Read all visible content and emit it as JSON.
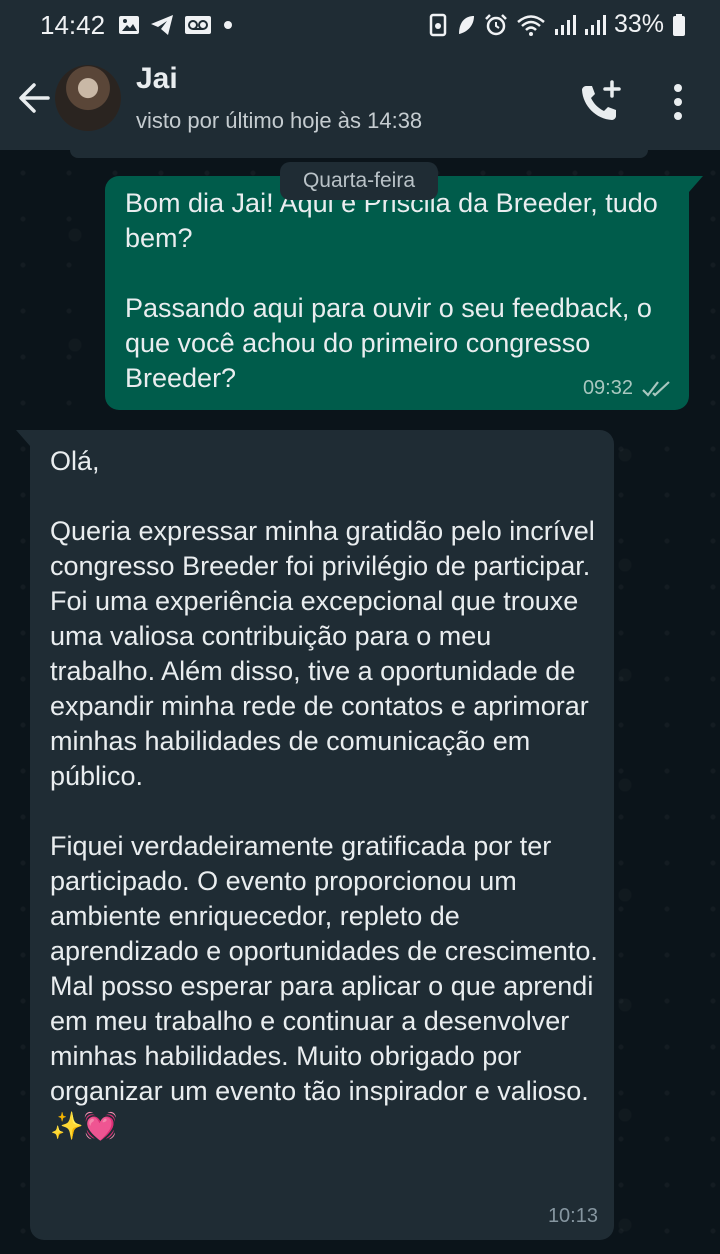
{
  "status_bar": {
    "time": "14:42",
    "battery_text": "33%"
  },
  "header": {
    "contact_name": "Jai",
    "last_seen": "visto por último hoje às 14:38"
  },
  "chat": {
    "date_label": "Quarta-feira",
    "outgoing": {
      "text": "Bom dia Jai! Aqui é Priscila da Breeder, tudo bem?\n\nPassando aqui para ouvir o seu feedback, o que você achou do primeiro congresso Breeder?",
      "time": "09:32",
      "status": "read"
    },
    "incoming": {
      "text": "Olá,\n\nQueria expressar minha gratidão pelo incrível congresso Breeder foi privilégio de participar. Foi uma experiência excepcional que trouxe uma valiosa contribuição para o meu trabalho. Além disso, tive a oportunidade de expandir minha rede de contatos e aprimorar minhas habilidades de comunicação em público.\n\nFiquei verdadeiramente gratificada por ter participado. O evento proporcionou um ambiente enriquecedor, repleto de aprendizado e oportunidades de crescimento. Mal posso esperar para aplicar o que aprendi em meu trabalho e continuar a desenvolver minhas habilidades. Muito obrigado por organizar um evento tão inspirador e valioso. ✨💓",
      "time": "10:13"
    }
  },
  "colors": {
    "header_bg": "#1f2c34",
    "chat_bg": "#0b141a",
    "outgoing_bubble": "#005c4b",
    "incoming_bubble": "#1f2c34",
    "read_ticks": "#a8c7bf"
  },
  "icons": {
    "status_left": [
      "gallery-icon",
      "telegram-icon",
      "voicemail-icon",
      "dot-icon"
    ],
    "status_right": [
      "data-saver-icon",
      "leaf-icon",
      "alarm-icon",
      "wifi-icon",
      "signal-icon",
      "signal-icon",
      "battery-icon"
    ],
    "header": [
      "back-arrow-icon",
      "add-call-icon",
      "more-vert-icon"
    ]
  }
}
